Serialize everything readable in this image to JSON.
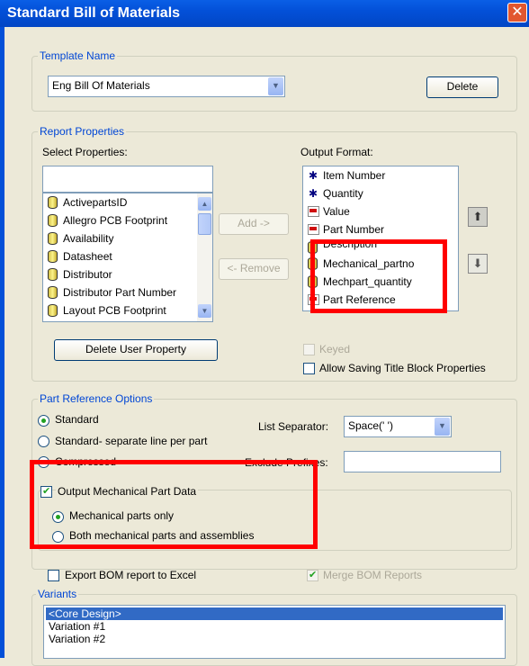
{
  "window": {
    "title": "Standard Bill of Materials",
    "close_glyph": "✕"
  },
  "template": {
    "legend": "Template Name",
    "selected": "Eng Bill Of Materials",
    "delete_label": "Delete"
  },
  "report": {
    "legend": "Report Properties",
    "select_label": "Select Properties:",
    "output_label": "Output Format:",
    "properties": [
      "ActivepartsID",
      "Allegro PCB Footprint",
      "Availability",
      "Datasheet",
      "Distributor",
      "Distributor Part Number",
      "Layout PCB Footprint"
    ],
    "add_label": "Add ->",
    "remove_label": "<- Remove",
    "output_items": [
      {
        "label": "Item Number",
        "icon": "star-icon"
      },
      {
        "label": "Quantity",
        "icon": "star-icon"
      },
      {
        "label": "Value",
        "icon": "property-icon"
      },
      {
        "label": "Part Number",
        "icon": "property-icon"
      },
      {
        "label": "Description",
        "icon": "property-icon"
      },
      {
        "label": "Mechanical_partno",
        "icon": "database-icon"
      },
      {
        "label": "Mechpart_quantity",
        "icon": "database-icon"
      },
      {
        "label": "Part Reference",
        "icon": "property-icon"
      }
    ],
    "delete_user_property": "Delete User Property",
    "keyed_label": "Keyed",
    "allow_saving_label": "Allow Saving Title Block Properties",
    "move_up_glyph": "⬆",
    "move_down_glyph": "⬇"
  },
  "partref": {
    "legend": "Part Reference Options",
    "standard": "Standard",
    "standard_separate": "Standard- separate line per part",
    "compressed": "Compressed",
    "list_separator_label": "List Separator:",
    "list_separator_value": "Space(' ')",
    "exclude_prefixes_label": "Exclude Prefixes:",
    "output_mech_label": "Output Mechanical Part Data",
    "mech_only": "Mechanical parts only",
    "both_mech": "Both mechanical parts and assemblies"
  },
  "export": {
    "export_excel": "Export BOM report to Excel",
    "merge_reports": "Merge BOM Reports"
  },
  "variants": {
    "legend": "Variants",
    "items": [
      "<Core Design>",
      "Variation #1",
      "Variation #2"
    ]
  },
  "colors": {
    "highlight_box": "#ff0000",
    "title_bar": "#0350d8"
  }
}
